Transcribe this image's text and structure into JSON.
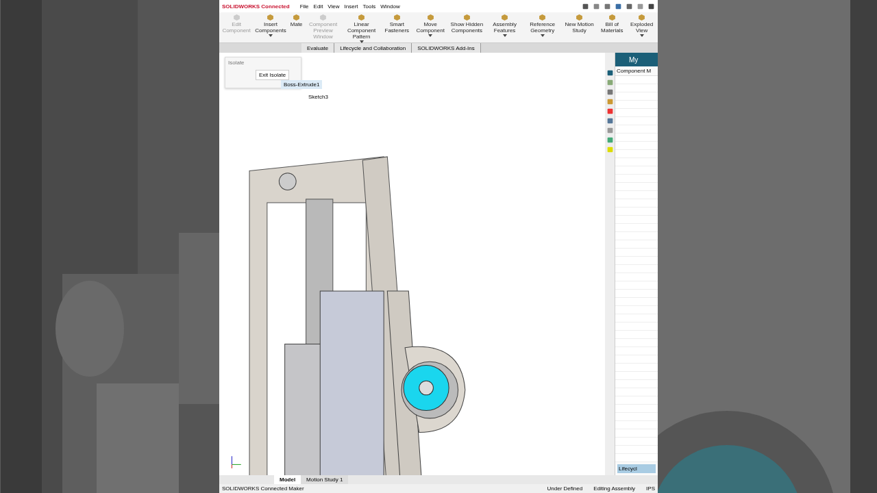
{
  "title_bar": {
    "app_name": "SOLIDWORKS Connected",
    "menus": [
      "File",
      "Edit",
      "View",
      "Insert",
      "Tools",
      "Window"
    ]
  },
  "ribbon": [
    {
      "label": "Edit Component",
      "disabled": true,
      "dropdown": false
    },
    {
      "label": "Insert Components",
      "disabled": false,
      "dropdown": true
    },
    {
      "label": "Mate",
      "disabled": false,
      "dropdown": false
    },
    {
      "label": "Component Preview Window",
      "disabled": true,
      "dropdown": false
    },
    {
      "label": "Linear Component Pattern",
      "disabled": false,
      "dropdown": true
    },
    {
      "label": "Smart Fasteners",
      "disabled": false,
      "dropdown": false
    },
    {
      "label": "Move Component",
      "disabled": false,
      "dropdown": true
    },
    {
      "label": "Show Hidden Components",
      "disabled": false,
      "dropdown": false
    },
    {
      "label": "Assembly Features",
      "disabled": false,
      "dropdown": true
    },
    {
      "label": "Reference Geometry",
      "disabled": false,
      "dropdown": true
    },
    {
      "label": "New Motion Study",
      "disabled": false,
      "dropdown": false
    },
    {
      "label": "Bill of Materials",
      "disabled": false,
      "dropdown": false
    },
    {
      "label": "Exploded View",
      "disabled": false,
      "dropdown": true
    }
  ],
  "command_tabs": [
    {
      "label": "Evaluate",
      "selected": false
    },
    {
      "label": "Lifecycle and Collaboration",
      "selected": false
    },
    {
      "label": "SOLIDWORKS Add-Ins",
      "selected": false
    }
  ],
  "isolate_popup": {
    "title": "Isolate",
    "button": "Exit Isolate"
  },
  "breadcrumb": {
    "feature": "Boss-Extrude1",
    "sketch": "Sketch3"
  },
  "task_pane": {
    "title": "My",
    "header": "Component M",
    "footer_tab": "Lifecycl"
  },
  "bottom_tabs": [
    {
      "label": "Model",
      "selected": true
    },
    {
      "label": "Motion Study 1",
      "selected": false
    }
  ],
  "status_bar": {
    "left": "SOLIDWORKS Connected Maker",
    "items": [
      "Under Defined",
      "Editing Assembly",
      "IPS"
    ]
  }
}
